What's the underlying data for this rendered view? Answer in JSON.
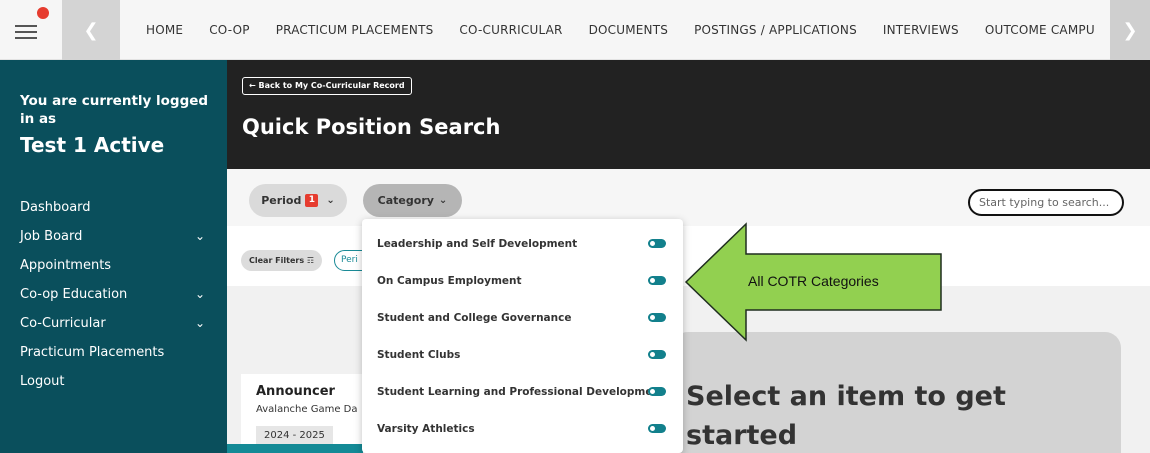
{
  "topnav": {
    "menu_icon": "hamburger-menu-icon",
    "items": [
      "HOME",
      "CO-OP",
      "PRACTICUM PLACEMENTS",
      "CO-CURRICULAR",
      "DOCUMENTS",
      "POSTINGS / APPLICATIONS",
      "INTERVIEWS",
      "OUTCOME CAMPU"
    ]
  },
  "sidebar": {
    "login_text": "You are currently logged in as",
    "user_name": "Test 1 Active",
    "items": [
      {
        "label": "Dashboard",
        "has_submenu": false
      },
      {
        "label": "Job Board",
        "has_submenu": true
      },
      {
        "label": "Appointments",
        "has_submenu": false
      },
      {
        "label": "Co-op Education",
        "has_submenu": true
      },
      {
        "label": "Co-Curricular",
        "has_submenu": true
      },
      {
        "label": "Practicum Placements",
        "has_submenu": false
      },
      {
        "label": "Logout",
        "has_submenu": false
      }
    ]
  },
  "header": {
    "back_label": "← Back to My Co-Curricular Record",
    "title": "Quick Position Search"
  },
  "filters": {
    "period_label": "Period",
    "period_badge": "1",
    "category_label": "Category",
    "search_placeholder": "Start typing to search...",
    "clear_label": "Clear Filters",
    "period_chip": "Peri"
  },
  "category_dropdown": {
    "items": [
      {
        "label": "Leadership and Self Development",
        "enabled": true
      },
      {
        "label": "On Campus Employment",
        "enabled": true
      },
      {
        "label": "Student and College Governance",
        "enabled": true
      },
      {
        "label": "Student Clubs",
        "enabled": true
      },
      {
        "label": "Student Learning and Professional Development",
        "enabled": true
      },
      {
        "label": "Varsity Athletics",
        "enabled": true
      }
    ]
  },
  "result": {
    "title": "Announcer",
    "subtitle": "Avalanche Game Da",
    "year": "2024 - 2025"
  },
  "empty_state": {
    "text": "Select an item to get started"
  },
  "callout": {
    "label": "All COTR Categories"
  },
  "colors": {
    "sidebar_bg": "#0a4f5c",
    "header_bg": "#222222",
    "accent_teal": "#12808c",
    "alert_red": "#e63c2f",
    "callout_green": "#92d050"
  }
}
